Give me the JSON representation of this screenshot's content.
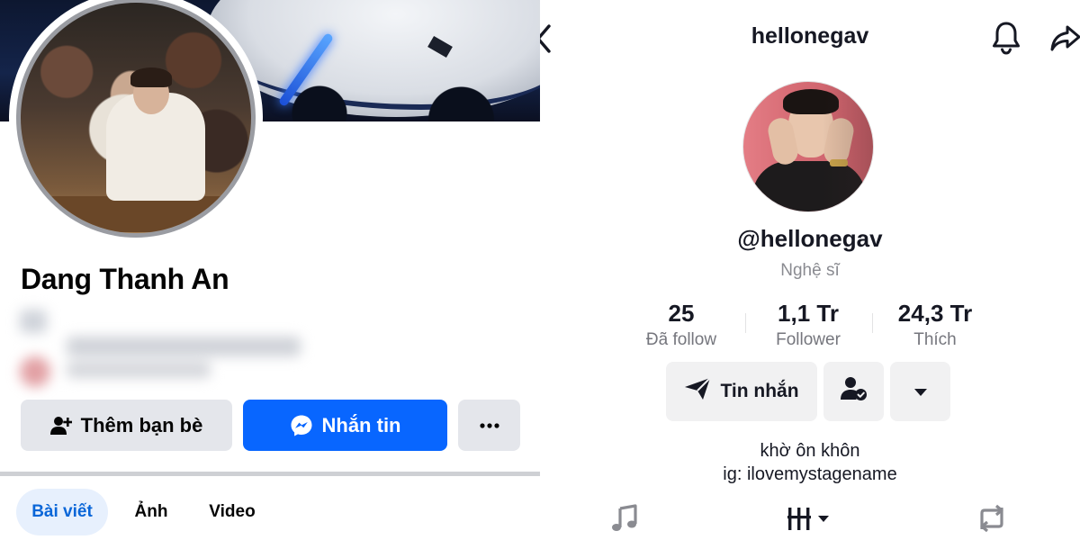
{
  "facebook": {
    "name": "Dang Thanh An",
    "add_friend_label": "Thêm bạn bè",
    "message_label": "Nhắn tin",
    "more_label": "···",
    "tabs": [
      {
        "label": "Bài viết",
        "active": true
      },
      {
        "label": "Ảnh",
        "active": false
      },
      {
        "label": "Video",
        "active": false
      }
    ],
    "colors": {
      "primary": "#0866ff",
      "secondary_button": "#e4e6eb",
      "active_tab_bg": "#e7f0fd",
      "active_tab_text": "#0a66d8"
    }
  },
  "tiktok": {
    "header_title": "hellonegav",
    "username": "@hellonegav",
    "category": "Nghệ sĩ",
    "stats": [
      {
        "value": "25",
        "label": "Đã follow"
      },
      {
        "value": "1,1 Tr",
        "label": "Follower"
      },
      {
        "value": "24,3 Tr",
        "label": "Thích"
      }
    ],
    "message_label": "Tin nhắn",
    "bio": [
      "khờ ôn khôn",
      "ig: ilovemystagename"
    ],
    "icons": [
      "back-icon",
      "bell-icon",
      "share-icon",
      "send-icon",
      "friend-check-icon",
      "dropdown-icon",
      "music-icon",
      "videos-grid-icon",
      "repost-icon"
    ]
  }
}
